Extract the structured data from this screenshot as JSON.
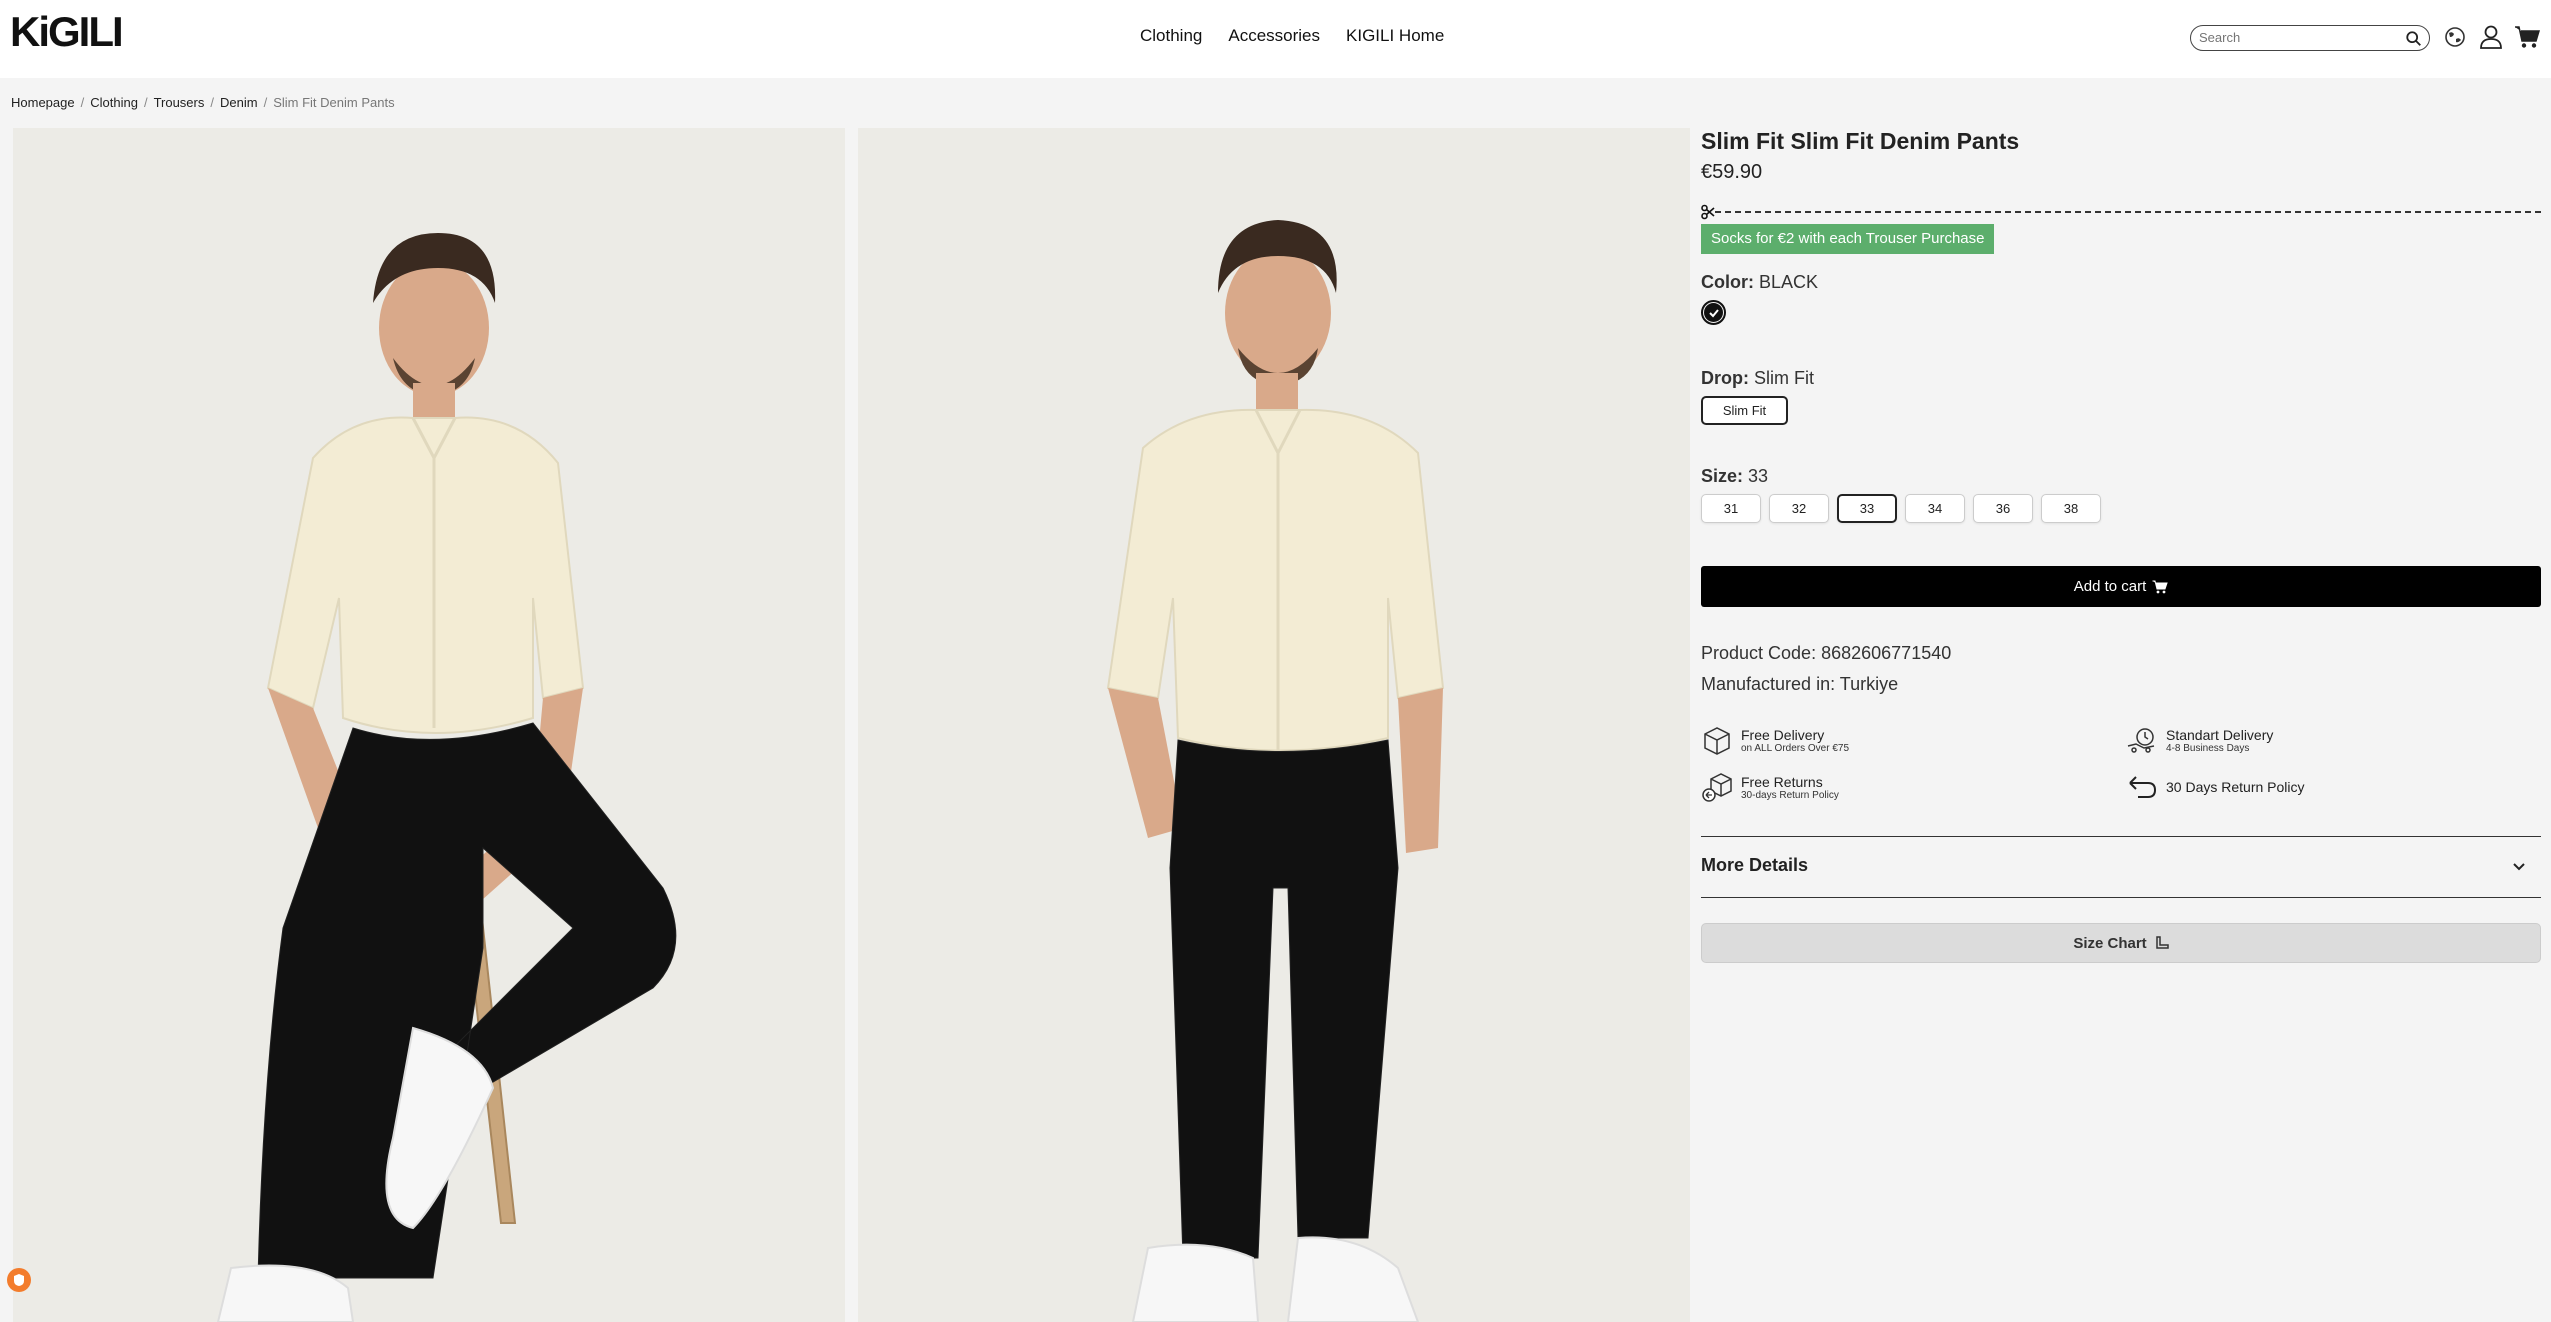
{
  "header": {
    "logo_text": "KiGILI",
    "nav": [
      "Clothing",
      "Accessories",
      "KIGILI Home"
    ],
    "search_placeholder": "Search"
  },
  "breadcrumb": {
    "items": [
      "Homepage",
      "Clothing",
      "Trousers",
      "Denim"
    ],
    "current": "Slim Fit Denim Pants",
    "separator": "/"
  },
  "product": {
    "title": "Slim Fit Slim Fit Denim Pants",
    "price": "€59.90",
    "promo": "Socks for €2 with each Trouser Purchase",
    "color_label": "Color:",
    "color_value": "BLACK",
    "swatch_color": "#111111",
    "drop_label": "Drop:",
    "drop_value": "Slim Fit",
    "drop_option": "Slim Fit",
    "size_label": "Size:",
    "size_value": "33",
    "sizes": [
      "31",
      "32",
      "33",
      "34",
      "36",
      "38"
    ],
    "selected_size": "33",
    "add_to_cart": "Add to cart",
    "product_code_label": "Product Code:",
    "product_code": "8682606771540",
    "manufactured_label": "Manufactured in:",
    "manufactured": "Turkiye",
    "features": [
      {
        "title": "Free Delivery",
        "sub": "on ALL Orders Over €75",
        "icon": "box-icon"
      },
      {
        "title": "Standart Delivery",
        "sub": "4-8 Business Days",
        "icon": "delivery-clock-icon"
      },
      {
        "title": "Free Returns",
        "sub": "30-days Return Policy",
        "icon": "return-box-icon"
      },
      {
        "title": "30 Days Return Policy",
        "sub": "",
        "icon": "return-arrow-icon"
      }
    ],
    "more_details": "More Details",
    "size_chart": "Size Chart"
  },
  "colors": {
    "promo_green": "#5cae6c",
    "cart_black": "#000000",
    "badge_orange": "#f37c2c"
  }
}
